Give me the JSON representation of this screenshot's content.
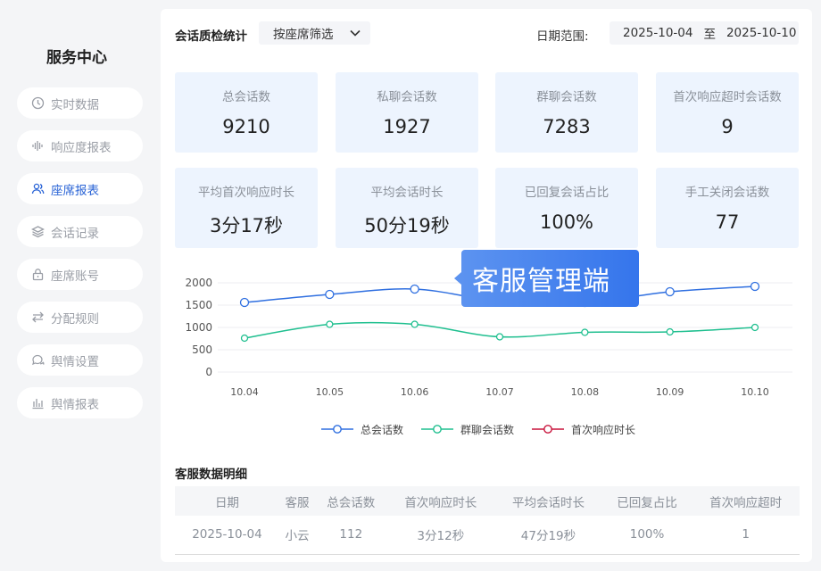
{
  "sidebar": {
    "title": "服务中心",
    "items": [
      {
        "label": "实时数据",
        "icon": "clock-icon"
      },
      {
        "label": "响应度报表",
        "icon": "sound-wave-icon"
      },
      {
        "label": "座席报表",
        "icon": "users-icon",
        "active": true
      },
      {
        "label": "会话记录",
        "icon": "layers-icon"
      },
      {
        "label": "座席账号",
        "icon": "lock-icon"
      },
      {
        "label": "分配规则",
        "icon": "swap-arrows-icon"
      },
      {
        "label": "舆情设置",
        "icon": "chat-bubbles-icon"
      },
      {
        "label": "舆情报表",
        "icon": "bar-chart-icon"
      }
    ]
  },
  "header": {
    "title": "会话质检统计",
    "seat_filter": "按座席筛选",
    "date_label": "日期范围:",
    "date_start": "2025-10-04",
    "date_sep": "至",
    "date_end": "2025-10-10"
  },
  "stats": [
    {
      "label": "总会话数",
      "value": "9210"
    },
    {
      "label": "私聊会话数",
      "value": "1927"
    },
    {
      "label": "群聊会话数",
      "value": "7283"
    },
    {
      "label": "首次响应超时会话数",
      "value": "9"
    },
    {
      "label": "平均首次响应时长",
      "value": "3分17秒"
    },
    {
      "label": "平均会话时长",
      "value": "50分19秒"
    },
    {
      "label": "已回复会话占比",
      "value": "100%"
    },
    {
      "label": "手工关闭会话数",
      "value": "77"
    }
  ],
  "tooltip": "客服管理端",
  "chart_data": {
    "type": "line",
    "x": [
      "10.04",
      "10.05",
      "10.06",
      "10.07",
      "10.08",
      "10.09",
      "10.10"
    ],
    "ylim": [
      0,
      2000
    ],
    "yticks": [
      0,
      500,
      1000,
      1500,
      2000
    ],
    "grid": true,
    "legend_position": "bottom",
    "series": [
      {
        "name": "总会话数",
        "color": "#2f6fe0",
        "values": [
          1560,
          1740,
          1860,
          1590,
          1560,
          1800,
          1920
        ]
      },
      {
        "name": "群聊会话数",
        "color": "#1fbf8f",
        "values": [
          760,
          1070,
          1070,
          790,
          890,
          900,
          1000
        ]
      },
      {
        "name": "首次响应时长",
        "color": "#c8143c",
        "values": []
      }
    ]
  },
  "table": {
    "title": "客服数据明细",
    "columns": [
      "日期",
      "客服",
      "总会话数",
      "首次响应时长",
      "平均会话时长",
      "已回复占比",
      "首次响应超时"
    ],
    "rows": [
      [
        "2025-10-04",
        "小云",
        "112",
        "3分12秒",
        "47分19秒",
        "100%",
        "1"
      ]
    ]
  }
}
